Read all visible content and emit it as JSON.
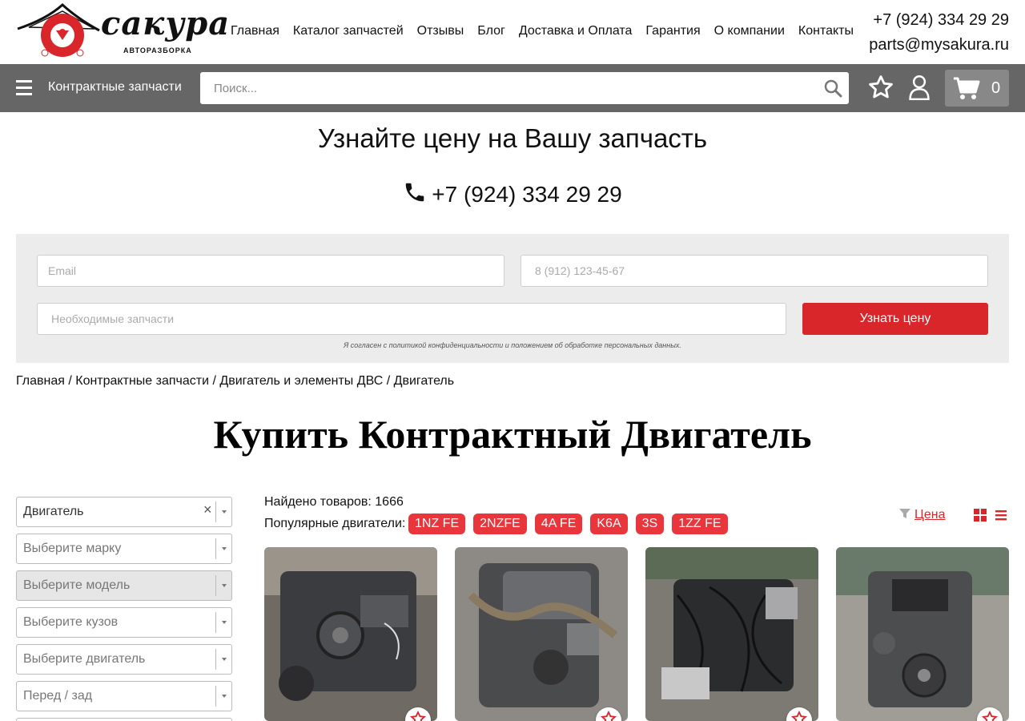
{
  "header": {
    "logo_text": "сакура",
    "logo_sub": "АВТОРАЗБОРКА",
    "nav": [
      "Главная",
      "Каталог запчастей",
      "Отзывы",
      "Блог",
      "Доставка и Оплата",
      "Гарантия",
      "О компании",
      "Контакты"
    ],
    "phone": "+7 (924) 334 29 29",
    "email": "parts@mysakura.ru"
  },
  "toolbar": {
    "category_label": "Контрактные запчасти",
    "search_placeholder": "Поиск...",
    "cart_count": "0"
  },
  "price_request": {
    "title": "Узнайте цену на Вашу запчасть",
    "phone": "+7 (924) 334 29 29",
    "email_placeholder": "Email",
    "phone_placeholder": "8 (912) 123-45-67",
    "parts_placeholder": "Необходимые запчасти",
    "submit_label": "Узнать цену",
    "consent": "Я согласен с политикой конфиденциальности и положением об обработке персональных данных."
  },
  "breadcrumb": [
    "Главная",
    "Контрактные запчасти",
    "Двигатель и элементы ДВС",
    "Двигатель"
  ],
  "breadcrumb_sep": " / ",
  "page_title": "Купить Контрактный Двигатель",
  "filters": {
    "category": "Двигатель",
    "clear_glyph": "×",
    "brand": "Выберите марку",
    "model": "Выберите модель",
    "body": "Выберите кузов",
    "engine": "Выберите двигатель",
    "position": "Перед / зад"
  },
  "products": {
    "found_label": "Найдено товаров:",
    "found_count": "1666",
    "popular_label": "Популярные двигатели:",
    "tags": [
      "1NZ FE",
      "2NZFE",
      "4A FE",
      "K6A",
      "3S",
      "1ZZ FE"
    ],
    "sort_label": "Цена"
  },
  "colors": {
    "accent": "#d8262b",
    "toolbar": "#666666",
    "tag": "#e8363c"
  }
}
